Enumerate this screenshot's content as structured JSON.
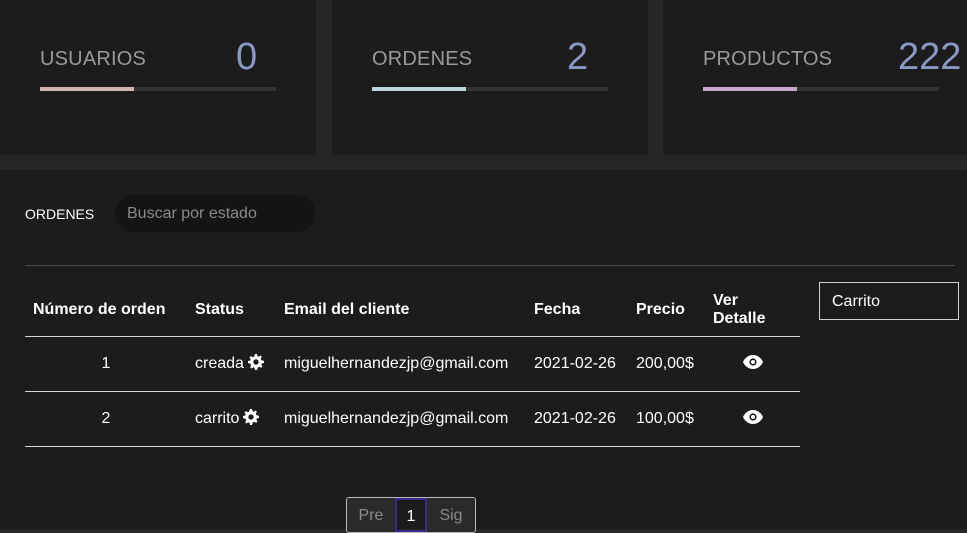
{
  "stats": {
    "users": {
      "label": "USUARIOS",
      "value": "0",
      "progress": 0.4,
      "color": "#d1b6b0"
    },
    "orders": {
      "label": "ORDENES",
      "value": "2",
      "progress": 0.4,
      "color": "#b8d4dc"
    },
    "products": {
      "label": "PRODUCTOS",
      "value": "222",
      "progress": 0.4,
      "color": "#c8a9cc"
    }
  },
  "orders_section": {
    "title": "ORDENES",
    "search_placeholder": "Buscar por estado"
  },
  "table": {
    "headers": [
      "Número de orden",
      "Status",
      "Email del cliente",
      "Fecha",
      "Precio",
      "Ver Detalle"
    ],
    "rows": [
      {
        "number": "1",
        "status": "creada",
        "email": "miguelhernandezjp@gmail.com",
        "date": "2021-02-26",
        "price": "200,00$"
      },
      {
        "number": "2",
        "status": "carrito",
        "email": "miguelhernandezjp@gmail.com",
        "date": "2021-02-26",
        "price": "100,00$"
      }
    ],
    "status_icon": "gear-icon",
    "detail_icon": "eye-icon"
  },
  "status_select": {
    "value": "Carrito"
  },
  "pagination": {
    "prev": "Pre",
    "current": "1",
    "next": "Sig"
  }
}
